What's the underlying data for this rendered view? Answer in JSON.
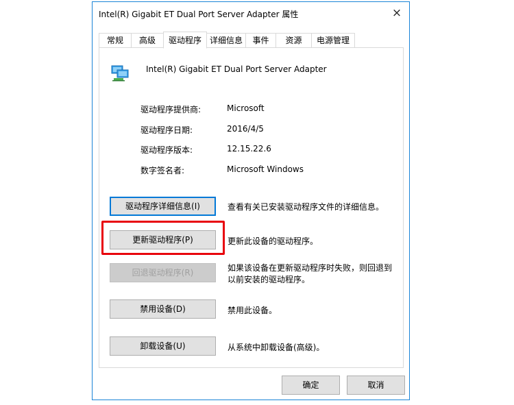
{
  "dialog": {
    "title": "Intel(R) Gigabit ET Dual Port Server Adapter 属性",
    "close_icon": "×"
  },
  "tabs": [
    {
      "label": "常规",
      "active": false
    },
    {
      "label": "高级",
      "active": false
    },
    {
      "label": "驱动程序",
      "active": true
    },
    {
      "label": "详细信息",
      "active": false
    },
    {
      "label": "事件",
      "active": false
    },
    {
      "label": "资源",
      "active": false
    },
    {
      "label": "电源管理",
      "active": false
    }
  ],
  "device": {
    "icon": "network-adapter-icon",
    "name": "Intel(R) Gigabit ET Dual Port Server Adapter"
  },
  "driver_info": [
    {
      "label": "驱动程序提供商:",
      "value": "Microsoft"
    },
    {
      "label": "驱动程序日期:",
      "value": "2016/4/5"
    },
    {
      "label": "驱动程序版本:",
      "value": "12.15.22.6"
    },
    {
      "label": "数字签名者:",
      "value": "Microsoft Windows"
    }
  ],
  "actions": [
    {
      "label": "驱动程序详细信息(I)",
      "desc": "查看有关已安装驱动程序文件的详细信息。",
      "enabled": true
    },
    {
      "label": "更新驱动程序(P)",
      "desc": "更新此设备的驱动程序。",
      "enabled": true,
      "highlighted": true
    },
    {
      "label": "回退驱动程序(R)",
      "desc": "如果该设备在更新驱动程序时失败，则回退到以前安装的驱动程序。",
      "enabled": false
    },
    {
      "label": "禁用设备(D)",
      "desc": "禁用此设备。",
      "enabled": true
    },
    {
      "label": "卸载设备(U)",
      "desc": "从系统中卸载设备(高级)。",
      "enabled": true
    }
  ],
  "footer": {
    "ok_label": "确定",
    "cancel_label": "取消"
  },
  "colors": {
    "highlight": "#e8000b",
    "focus": "#0078d7",
    "window_border": "#1883d7"
  }
}
